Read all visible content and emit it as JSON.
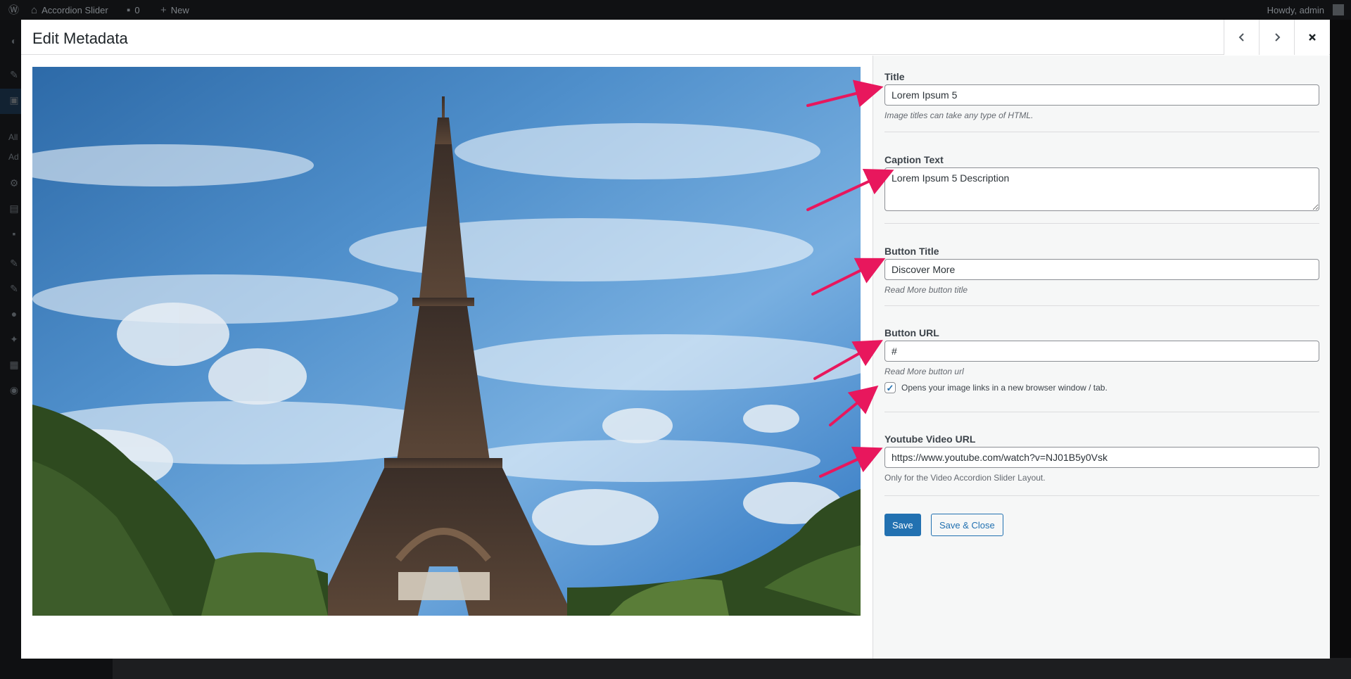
{
  "admin_bar": {
    "site_name": "Accordion Slider",
    "comments_count": "0",
    "new_label": "New",
    "greeting": "Howdy, admin"
  },
  "side_menu": {
    "sub_item_1": "All",
    "sub_item_2": "Ad"
  },
  "modal": {
    "title": "Edit Metadata",
    "prev_icon": "chevron-left-icon",
    "next_icon": "chevron-right-icon",
    "close_icon": "close-icon"
  },
  "image": {
    "subject": "Eiffel Tower under blue sky with clouds"
  },
  "form": {
    "title": {
      "label": "Title",
      "value": "Lorem Ipsum 5",
      "hint": "Image titles can take any type of HTML."
    },
    "caption": {
      "label": "Caption Text",
      "value": "Lorem Ipsum 5 Description"
    },
    "button_title": {
      "label": "Button Title",
      "value": "Discover More",
      "hint": "Read More button title"
    },
    "button_url": {
      "label": "Button URL",
      "value": "#",
      "hint": "Read More button url"
    },
    "new_window": {
      "label": "Opens your image links in a new browser window / tab.",
      "checked": true
    },
    "youtube": {
      "label": "Youtube Video URL",
      "value": "https://www.youtube.com/watch?v=NJ01B5y0Vsk",
      "hint": "Only for the Video Accordion Slider Layout."
    },
    "save_label": "Save",
    "save_close_label": "Save & Close"
  },
  "colors": {
    "accent": "#2271b1",
    "annotation_arrow": "#e8175d"
  }
}
